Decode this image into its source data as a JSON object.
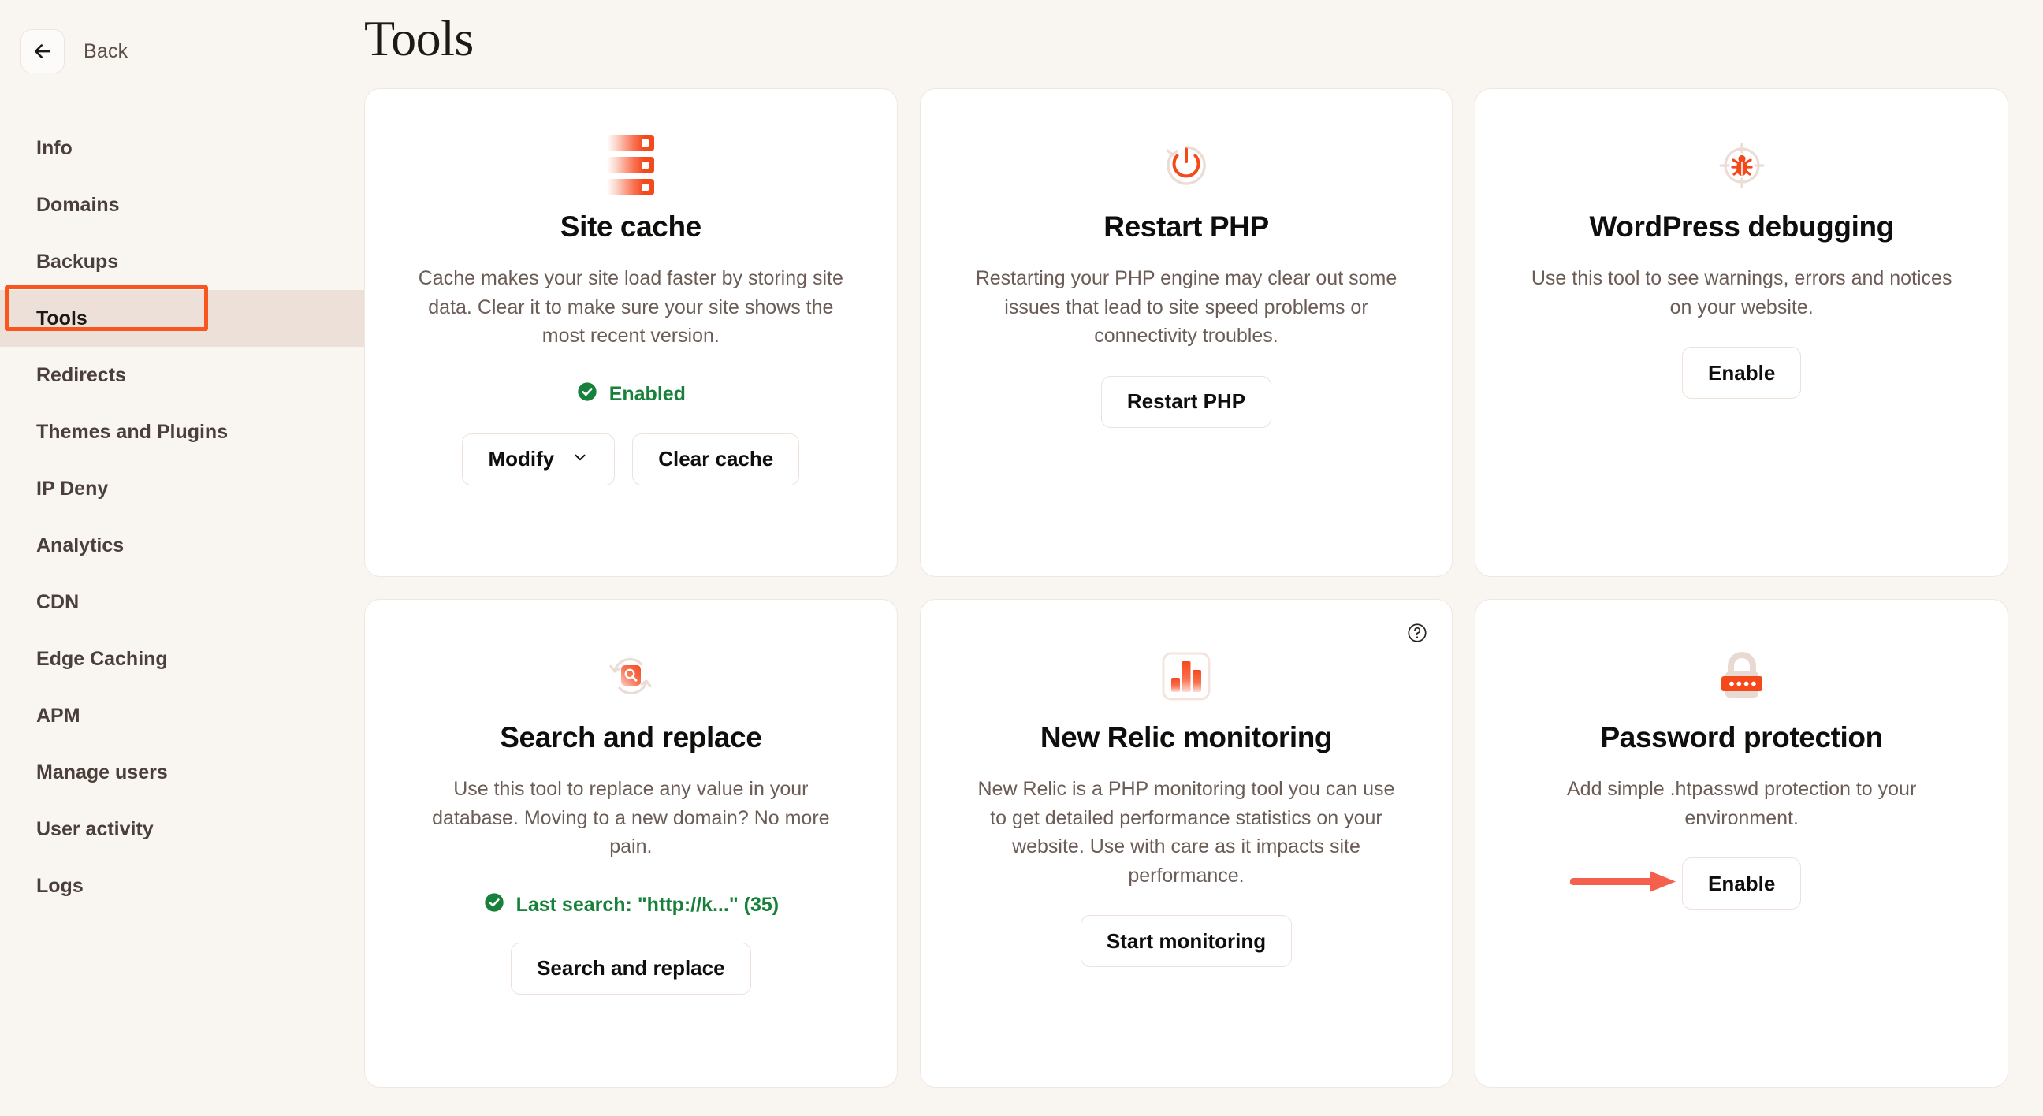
{
  "sidebar": {
    "back_label": "Back",
    "items": [
      {
        "label": "Info",
        "active": false
      },
      {
        "label": "Domains",
        "active": false
      },
      {
        "label": "Backups",
        "active": false
      },
      {
        "label": "Tools",
        "active": true
      },
      {
        "label": "Redirects",
        "active": false
      },
      {
        "label": "Themes and Plugins",
        "active": false
      },
      {
        "label": "IP Deny",
        "active": false
      },
      {
        "label": "Analytics",
        "active": false
      },
      {
        "label": "CDN",
        "active": false
      },
      {
        "label": "Edge Caching",
        "active": false
      },
      {
        "label": "APM",
        "active": false
      },
      {
        "label": "Manage users",
        "active": false
      },
      {
        "label": "User activity",
        "active": false
      },
      {
        "label": "Logs",
        "active": false
      }
    ]
  },
  "page": {
    "title": "Tools"
  },
  "cards": {
    "site_cache": {
      "icon": "server-stack-icon",
      "title": "Site cache",
      "description": "Cache makes your site load faster by storing site data. Clear it to make sure your site shows the most recent version.",
      "status": "Enabled",
      "status_color": "#17803A",
      "primary_label": "Modify",
      "secondary_label": "Clear cache"
    },
    "restart_php": {
      "icon": "power-restart-icon",
      "title": "Restart PHP",
      "description": "Restarting your PHP engine may clear out some issues that lead to site speed problems or connectivity troubles.",
      "button_label": "Restart PHP"
    },
    "wordpress_debugging": {
      "icon": "bug-target-icon",
      "title": "WordPress debugging",
      "description": "Use this tool to see warnings, errors and notices on your website.",
      "button_label": "Enable"
    },
    "search_and_replace": {
      "icon": "search-refresh-icon",
      "title": "Search and replace",
      "description": "Use this tool to replace any value in your database. Moving to a new domain? No more pain.",
      "status": "Last search: \"http://k...\" (35)",
      "status_color": "#17803A",
      "button_label": "Search and replace"
    },
    "new_relic_monitoring": {
      "icon": "bar-chart-icon",
      "help_icon": "question-mark-circle-icon",
      "title": "New Relic monitoring",
      "description": "New Relic is a PHP monitoring tool you can use to get detailed performance statistics on your website. Use with care as it impacts site performance.",
      "button_label": "Start monitoring"
    },
    "password_protection": {
      "icon": "padlock-icon",
      "title": "Password protection",
      "description": "Add simple .htpasswd protection to your environment.",
      "button_label": "Enable"
    }
  },
  "annotations": {
    "nav_highlight_color": "#F8561E",
    "arrow_color": "#F4604C",
    "arrow_target": "Enable"
  },
  "theme": {
    "background": "#F9F5F1",
    "card_background": "#FFFFFF",
    "accent": "#F4491B",
    "active_nav_background": "#EDE0D8"
  }
}
